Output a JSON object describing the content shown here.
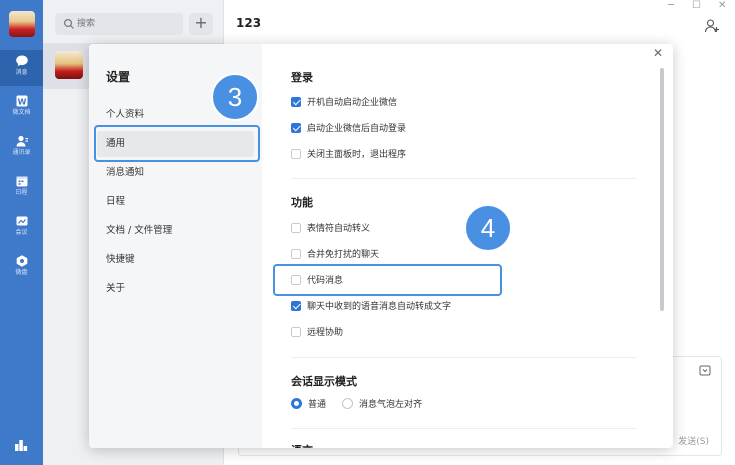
{
  "nav": {
    "items": [
      {
        "label": "消息",
        "icon": "chat-bubble-icon"
      },
      {
        "label": "微文档",
        "icon": "doc-icon"
      },
      {
        "label": "通讯录",
        "icon": "contacts-icon"
      },
      {
        "label": "日程",
        "icon": "calendar-icon"
      },
      {
        "label": "会议",
        "icon": "meeting-icon"
      },
      {
        "label": "微盘",
        "icon": "drive-icon"
      }
    ]
  },
  "search": {
    "placeholder": "搜索"
  },
  "chat": {
    "title": "123",
    "send_label": "发送(S)"
  },
  "settings": {
    "title": "设置",
    "menu": [
      "个人资料",
      "通用",
      "消息通知",
      "日程",
      "文档 / 文件管理",
      "快捷键",
      "关于"
    ],
    "selected_index": 1,
    "sections": {
      "login": {
        "title": "登录",
        "options": [
          {
            "label": "开机自动启动企业微信",
            "checked": true
          },
          {
            "label": "启动企业微信后自动登录",
            "checked": true
          },
          {
            "label": "关闭主面板时，退出程序",
            "checked": false
          }
        ]
      },
      "features": {
        "title": "功能",
        "options": [
          {
            "label": "表情符自动转义",
            "checked": false
          },
          {
            "label": "合并免打扰的聊天",
            "checked": false
          },
          {
            "label": "代码消息",
            "checked": false
          },
          {
            "label": "聊天中收到的语音消息自动转成文字",
            "checked": true
          },
          {
            "label": "远程协助",
            "checked": false
          }
        ]
      },
      "display_mode": {
        "title": "会话显示模式",
        "options": [
          {
            "label": "普通",
            "selected": true
          },
          {
            "label": "消息气泡左对齐",
            "selected": false
          }
        ]
      },
      "language": {
        "title": "语言"
      }
    }
  },
  "annotations": {
    "step_a": "3",
    "step_b": "4",
    "color": "#4a90e2"
  }
}
